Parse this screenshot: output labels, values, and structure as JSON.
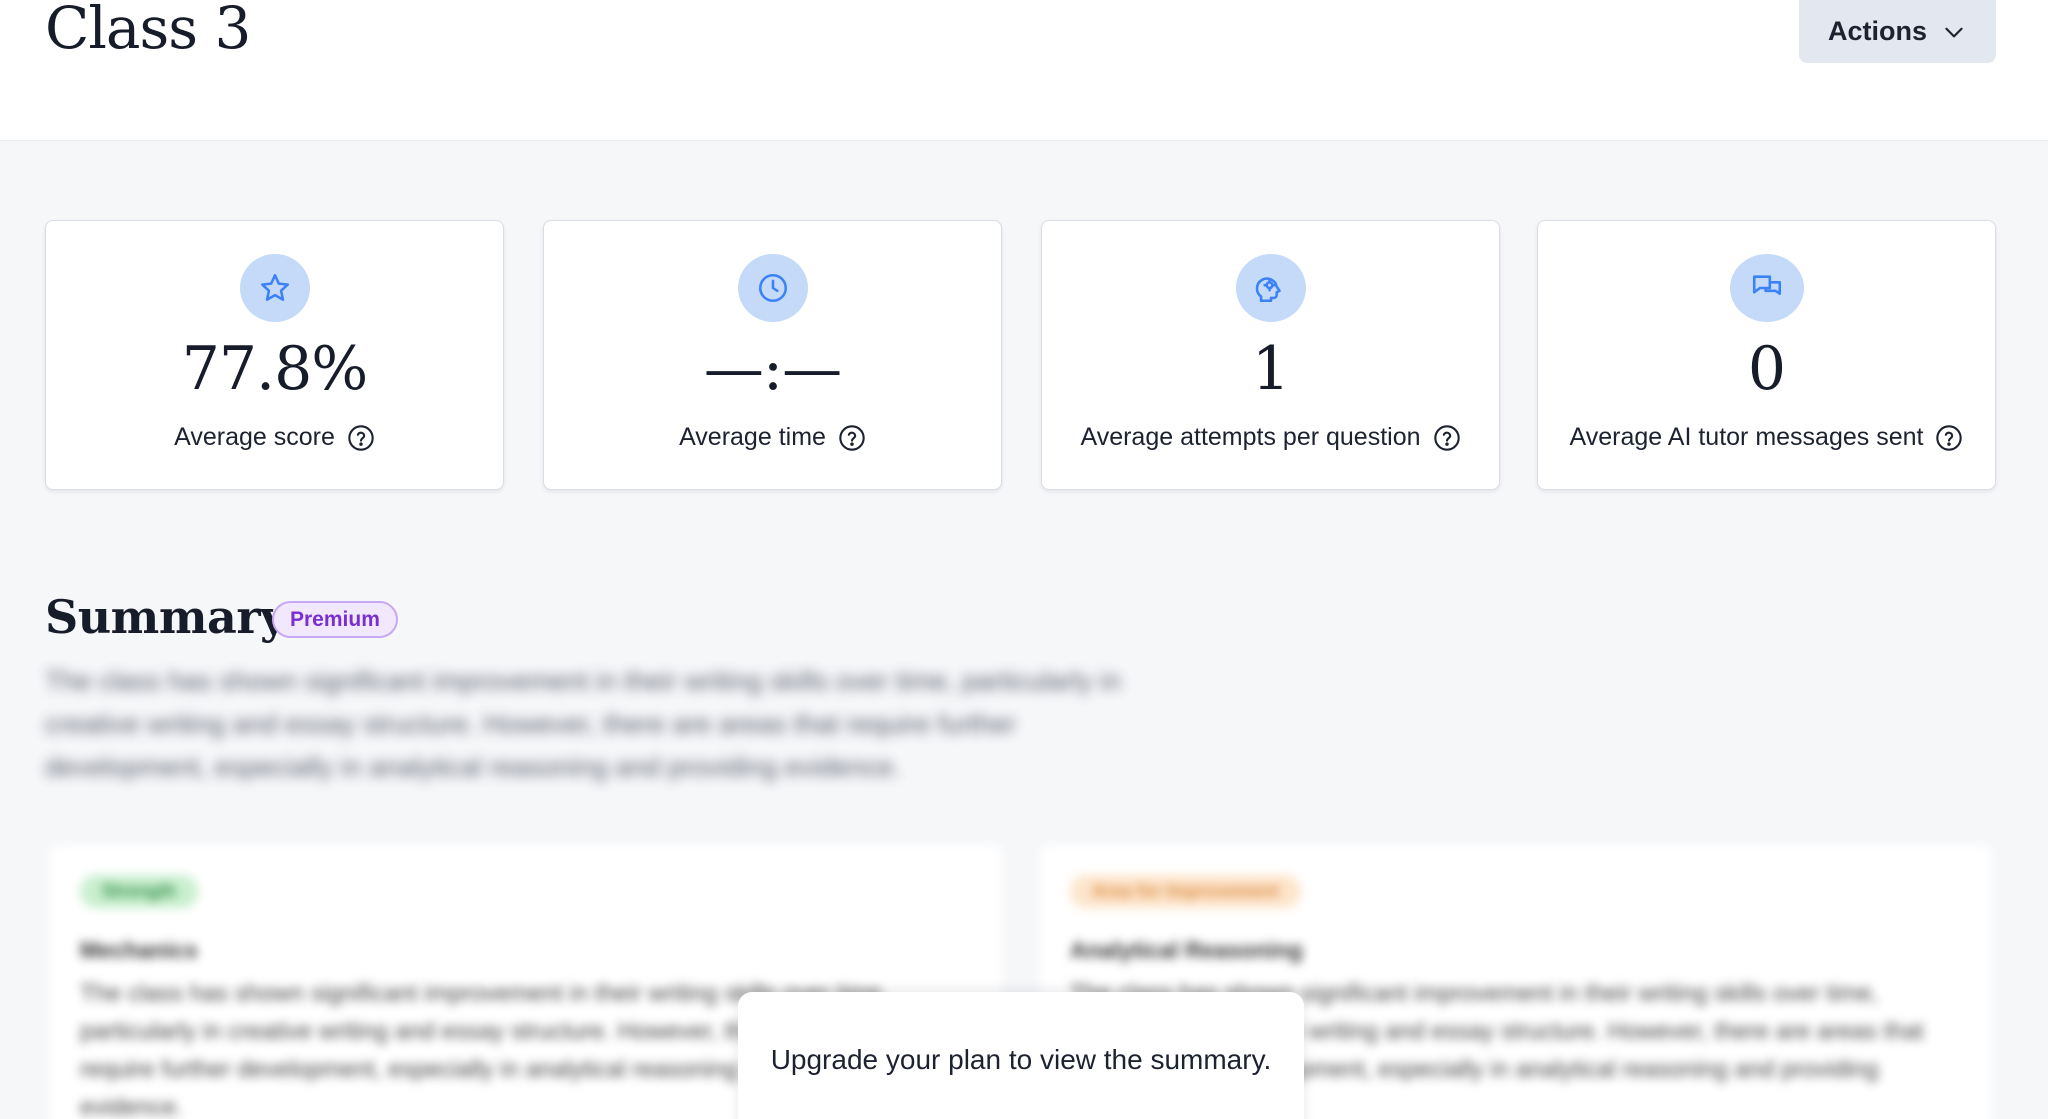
{
  "header": {
    "title": "Class 3",
    "actions_label": "Actions"
  },
  "metrics": [
    {
      "icon": "star-icon",
      "value": "77.8%",
      "label": "Average score"
    },
    {
      "icon": "clock-icon",
      "value": "—:—",
      "label": "Average time"
    },
    {
      "icon": "brain-gear-icon",
      "value": "1",
      "label": "Average attempts per question"
    },
    {
      "icon": "chat-bubbles-icon",
      "value": "0",
      "label": "Average AI tutor messages sent"
    }
  ],
  "summary": {
    "title": "Summary",
    "badge": "Premium",
    "text": "The class has shown significant improvement in their writing skills over time, particularly in creative writing and essay structure. However, there are areas that require further development, especially in analytical reasoning and providing evidence.",
    "cards": [
      {
        "tag": "Strength",
        "title": "Mechanics",
        "text": "The class has shown significant improvement in their writing skills over time, particularly in creative writing and essay structure. However, there are areas that require further development, especially in analytical reasoning and providing evidence."
      },
      {
        "tag": "Area for Improvement",
        "title": "Analytical Reasoning",
        "text": "The class has shown significant improvement in their writing skills over time, particularly in creative writing and essay structure. However, there are areas that require further development, especially in analytical reasoning and providing evidence."
      }
    ],
    "upgrade_message": "Upgrade your plan to view the summary."
  },
  "colors": {
    "accent_icon": "#3b82f6",
    "icon_bg": "#c4daf8",
    "premium": "#7a2fd1",
    "strength_bg": "#c9efcf",
    "improvement_bg": "#fde5cc"
  }
}
